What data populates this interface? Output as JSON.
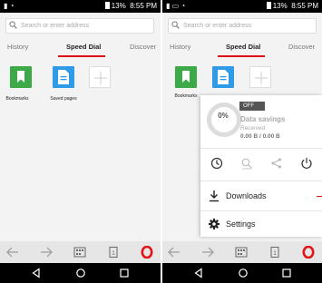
{
  "status": {
    "battery": "13%",
    "time": "8:55 PM"
  },
  "search": {
    "placeholder": "Search or enter address"
  },
  "tabs": [
    "History",
    "Speed Dial",
    "Discover"
  ],
  "speed_dial": {
    "bookmarks": "Bookmarks",
    "saved_pages": "Saved pages"
  },
  "menu": {
    "toggle": "OFF",
    "savings_title": "Data savings",
    "received_label": "Received",
    "received_value": "0.00 B / 0.00 B",
    "percent": "0%",
    "downloads": "Downloads",
    "settings": "Settings"
  },
  "colors": {
    "accent": "#d11f1f",
    "green_tile": "#3daa48",
    "blue_tile": "#2f9be8"
  }
}
